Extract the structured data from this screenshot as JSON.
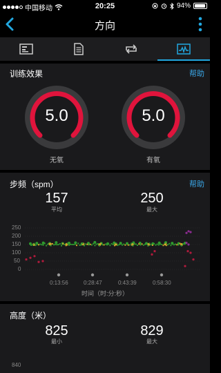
{
  "status_bar": {
    "carrier": "中国移动",
    "time": "20:25",
    "battery": "94%",
    "battery_level": 0.94
  },
  "nav": {
    "title": "方向",
    "icons": [
      "back-chevron-icon",
      "more-vertical-icon"
    ]
  },
  "tabs": [
    {
      "icon": "activity-chart-icon"
    },
    {
      "icon": "list-icon"
    },
    {
      "icon": "repeat-icon"
    },
    {
      "icon": "graph-icon",
      "active": true
    }
  ],
  "colors": {
    "accent": "#22a8e0",
    "help_link": "#3aa6e6",
    "gauge_red": "#e0143c",
    "section_bg": "#1a1a1c"
  },
  "training_effect": {
    "title": "训练效果",
    "help": "帮助",
    "anaerobic": {
      "value": "5.0",
      "label": "无氧"
    },
    "aerobic": {
      "value": "5.0",
      "label": "有氧"
    }
  },
  "cadence": {
    "title": "步频（spm）",
    "help": "帮助",
    "avg": {
      "value": "157",
      "label": "平均"
    },
    "max": {
      "value": "250",
      "label": "最大"
    },
    "y_ticks": [
      "250",
      "200",
      "150",
      "100",
      "50",
      "0"
    ],
    "x_ticks": [
      "0:13:56",
      "0:28:47",
      "0:43:39",
      "0:58:30"
    ],
    "x_label": "时间（时:分:秒）"
  },
  "elevation": {
    "title": "高度（米）",
    "min": {
      "value": "825",
      "label": "最小"
    },
    "max": {
      "value": "829",
      "label": "最大"
    },
    "y_tick_top": "840"
  },
  "chart_data": {
    "type": "scatter",
    "xlabel": "时间（时:分:秒）",
    "ylabel": "",
    "ylim": [
      0,
      250
    ],
    "x_ticks": [
      "0:13:56",
      "0:28:47",
      "0:43:39",
      "0:58:30"
    ],
    "series": [
      {
        "color": "#2e9a2e",
        "y": [
          155,
          158,
          160,
          157,
          162,
          156,
          159,
          161,
          154,
          158,
          163,
          157,
          155,
          160,
          158,
          156,
          161,
          159,
          157,
          155,
          160,
          162,
          158,
          156,
          159
        ]
      },
      {
        "color": "#d3a62a",
        "y": [
          150,
          152,
          151,
          153,
          149,
          152,
          150,
          151,
          153,
          150
        ]
      },
      {
        "color": "#b01a3c",
        "y": [
          60,
          70,
          80,
          45,
          50,
          90,
          110,
          20,
          110,
          100,
          60
        ]
      },
      {
        "color": "#8a2b8f",
        "y": [
          220,
          230,
          225,
          160,
          150
        ]
      }
    ]
  }
}
